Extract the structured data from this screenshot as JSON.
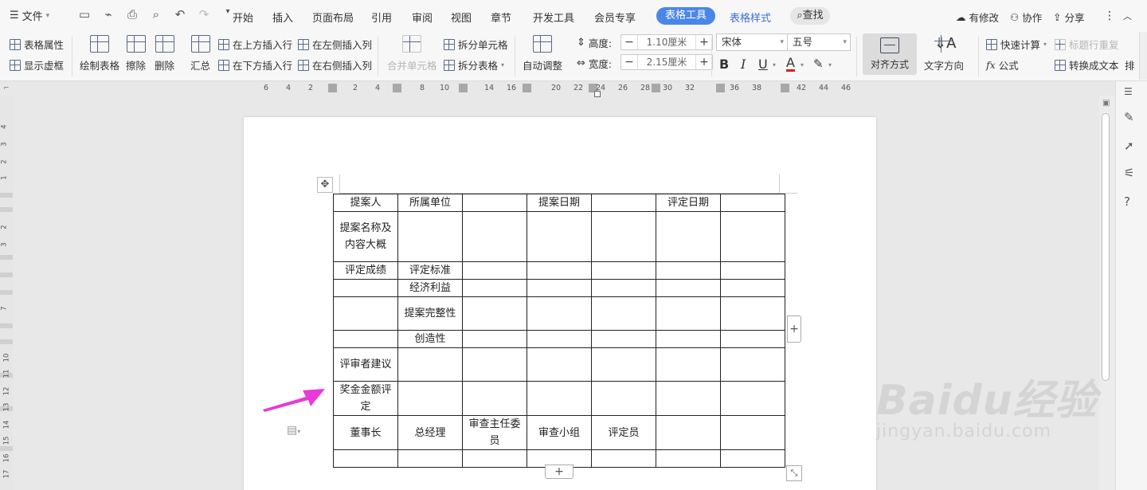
{
  "menubar": {
    "file": "文件",
    "menus": [
      "开始",
      "插入",
      "页面布局",
      "引用",
      "审阅",
      "视图",
      "章节",
      "开发工具",
      "会员专享"
    ],
    "active_tab": "表格工具",
    "tab2": "表格样式",
    "search": "查找",
    "has_changes": "有修改",
    "collab": "协作",
    "share": "分享"
  },
  "ribbon": {
    "table_props": "表格属性",
    "show_grid": "显示虚框",
    "draw_table": "绘制表格",
    "erase": "擦除",
    "delete": "删除",
    "summary": "汇总",
    "insert_above": "在上方插入行",
    "insert_below": "在下方插入行",
    "insert_left": "在左侧插入列",
    "insert_right": "在右侧插入列",
    "merge": "合并单元格",
    "split_cell": "拆分单元格",
    "split_table": "拆分表格",
    "auto_adjust": "自动调整",
    "height_label": "高度:",
    "height_value": "1.10厘米",
    "width_label": "宽度:",
    "width_value": "2.15厘米",
    "font_name": "宋体",
    "font_size": "五号",
    "align": "对齐方式",
    "text_dir": "文字方向",
    "quick_calc": "快速计算",
    "repeat_header": "标题行重复",
    "formula": "公式",
    "to_text": "转换成文本",
    "more": "排"
  },
  "ruler": {
    "h_numbers": [
      "6",
      "4",
      "2",
      "2",
      "4",
      "8",
      "10",
      "14",
      "16",
      "20",
      "22",
      "24",
      "26",
      "28",
      "30",
      "32",
      "36",
      "38",
      "42",
      "44",
      "46"
    ],
    "v_numbers": [
      "4",
      "3",
      "2",
      "1",
      "2",
      "3",
      "7",
      "10",
      "11",
      "12",
      "13",
      "14",
      "15",
      "16",
      "17"
    ]
  },
  "table": {
    "rows": [
      [
        "提案人",
        "所属单位",
        "",
        "提案日期",
        "",
        "评定日期",
        ""
      ],
      [
        "提案名称及内容大概",
        "",
        "",
        "",
        "",
        "",
        ""
      ],
      [
        "评定成绩",
        "评定标准",
        "",
        "",
        "",
        "",
        ""
      ],
      [
        "",
        "经济利益",
        "",
        "",
        "",
        "",
        ""
      ],
      [
        "",
        "提案完整性",
        "",
        "",
        "",
        "",
        ""
      ],
      [
        "",
        "创造性",
        "",
        "",
        "",
        "",
        ""
      ],
      [
        "评审者建议",
        "",
        "",
        "",
        "",
        "",
        ""
      ],
      [
        "奖金金额评定",
        "",
        "",
        "",
        "",
        "",
        ""
      ],
      [
        "董事长",
        "总经理",
        "审查主任委员",
        "审查小组",
        "评定员",
        "",
        ""
      ],
      [
        "",
        "",
        "",
        "",
        "",
        "",
        ""
      ]
    ]
  },
  "watermark": {
    "brand": "Baidu经验",
    "url": "jingyan.baidu.com"
  },
  "colors": {
    "accent": "#4a86e8",
    "arrow": "#e83ad8"
  }
}
